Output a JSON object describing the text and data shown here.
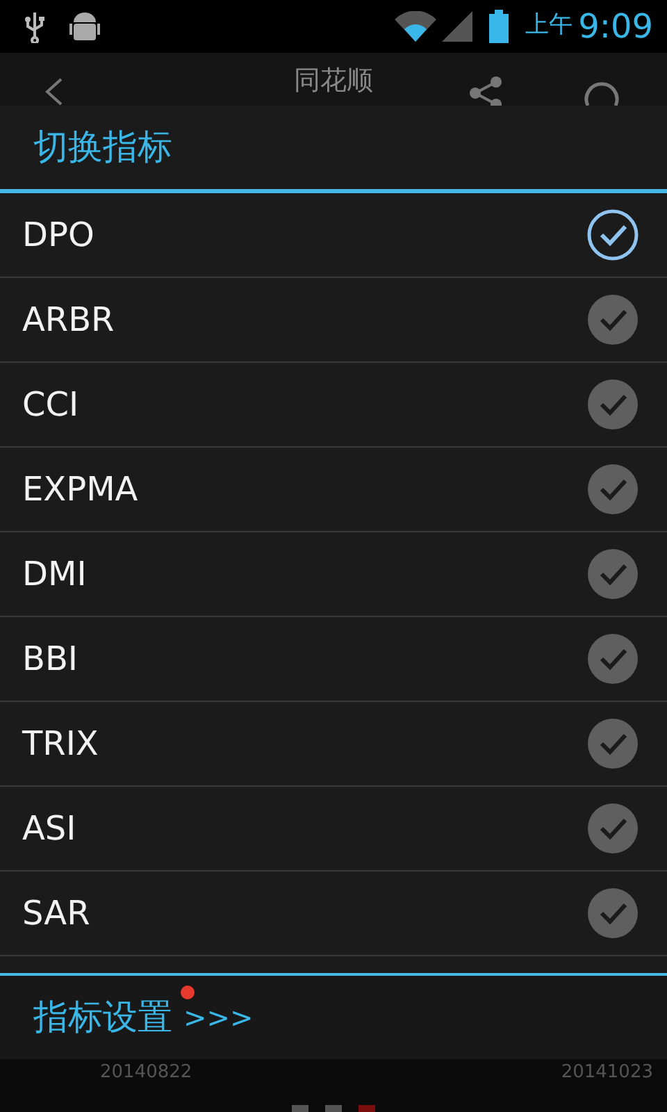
{
  "status_bar": {
    "ampm": "上午",
    "time": "9:09"
  },
  "app_bar": {
    "title": "同花顺"
  },
  "dialog": {
    "title": "切换指标",
    "items": [
      {
        "label": "DPO",
        "selected": true
      },
      {
        "label": "ARBR",
        "selected": false
      },
      {
        "label": "CCI",
        "selected": false
      },
      {
        "label": "EXPMA",
        "selected": false
      },
      {
        "label": "DMI",
        "selected": false
      },
      {
        "label": "BBI",
        "selected": false
      },
      {
        "label": "TRIX",
        "selected": false
      },
      {
        "label": "ASI",
        "selected": false
      },
      {
        "label": "SAR",
        "selected": false
      }
    ],
    "footer": {
      "label": "指标设置",
      "arrows": ">>>",
      "new_dot": true
    }
  },
  "chart_footer": {
    "start_date": "20140822",
    "end_date": "20141023"
  },
  "page_indicator": [
    {
      "selected": false
    },
    {
      "selected": false
    },
    {
      "selected": true
    }
  ]
}
